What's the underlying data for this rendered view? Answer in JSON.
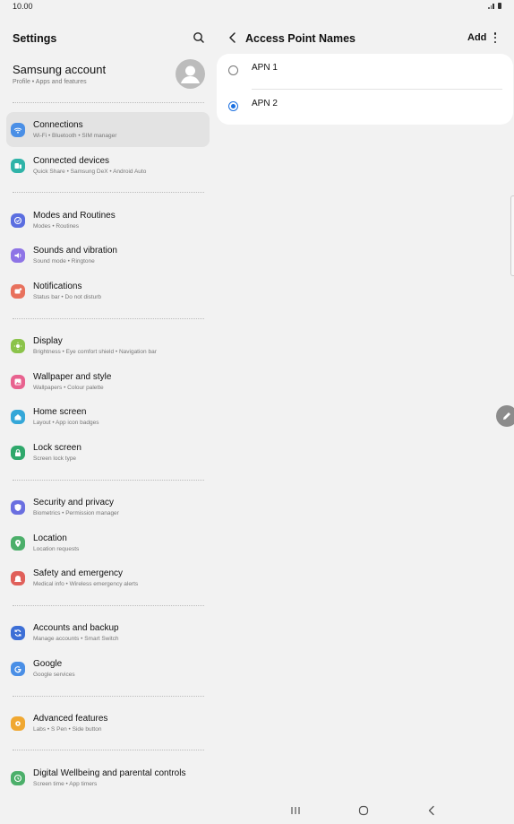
{
  "status": {
    "time": "10.00"
  },
  "settings": {
    "title": "Settings",
    "account": {
      "title": "Samsung account",
      "subtitle": "Profile  •  Apps and features"
    },
    "items": [
      {
        "title": "Connections",
        "subtitle": "Wi-Fi  •  Bluetooth  •  SIM manager",
        "icon": "wifi-icon",
        "color": "#4a8fe6"
      },
      {
        "title": "Connected devices",
        "subtitle": "Quick Share  •  Samsung DeX  •  Android Auto",
        "icon": "connected-devices-icon",
        "color": "#2fb3a8"
      },
      {
        "title": "Modes and Routines",
        "subtitle": "Modes  •  Routines",
        "icon": "modes-icon",
        "color": "#5b6ee0"
      },
      {
        "title": "Sounds and vibration",
        "subtitle": "Sound mode  •  Ringtone",
        "icon": "sound-icon",
        "color": "#8e74e6"
      },
      {
        "title": "Notifications",
        "subtitle": "Status bar  •  Do not disturb",
        "icon": "notification-icon",
        "color": "#e8715d"
      },
      {
        "title": "Display",
        "subtitle": "Brightness  •  Eye comfort shield  •  Navigation bar",
        "icon": "display-icon",
        "color": "#8bc34a"
      },
      {
        "title": "Wallpaper and style",
        "subtitle": "Wallpapers  •  Colour palette",
        "icon": "wallpaper-icon",
        "color": "#e8628f"
      },
      {
        "title": "Home screen",
        "subtitle": "Layout  •  App icon badges",
        "icon": "home-icon",
        "color": "#35a7d8"
      },
      {
        "title": "Lock screen",
        "subtitle": "Screen lock type",
        "icon": "lock-icon",
        "color": "#2fa86b"
      },
      {
        "title": "Security and privacy",
        "subtitle": "Biometrics  •  Permission manager",
        "icon": "shield-icon",
        "color": "#6a6fe0"
      },
      {
        "title": "Location",
        "subtitle": "Location requests",
        "icon": "location-icon",
        "color": "#4caf6a"
      },
      {
        "title": "Safety and emergency",
        "subtitle": "Medical info  •  Wireless emergency alerts",
        "icon": "emergency-icon",
        "color": "#e0605a"
      },
      {
        "title": "Accounts and backup",
        "subtitle": "Manage accounts  •  Smart Switch",
        "icon": "sync-icon",
        "color": "#3d6fd6"
      },
      {
        "title": "Google",
        "subtitle": "Google services",
        "icon": "google-icon",
        "color": "#4a8fe6"
      },
      {
        "title": "Advanced features",
        "subtitle": "Labs  •  S Pen  •  Side button",
        "icon": "gear-icon",
        "color": "#f0a832"
      },
      {
        "title": "Digital Wellbeing and parental controls",
        "subtitle": "Screen time  •  App timers",
        "icon": "wellbeing-icon",
        "color": "#4caf6a"
      }
    ]
  },
  "apn": {
    "title": "Access Point Names",
    "add_label": "Add",
    "entries": [
      {
        "label": "APN 1",
        "selected": false
      },
      {
        "label": "APN 2",
        "selected": true
      }
    ]
  }
}
